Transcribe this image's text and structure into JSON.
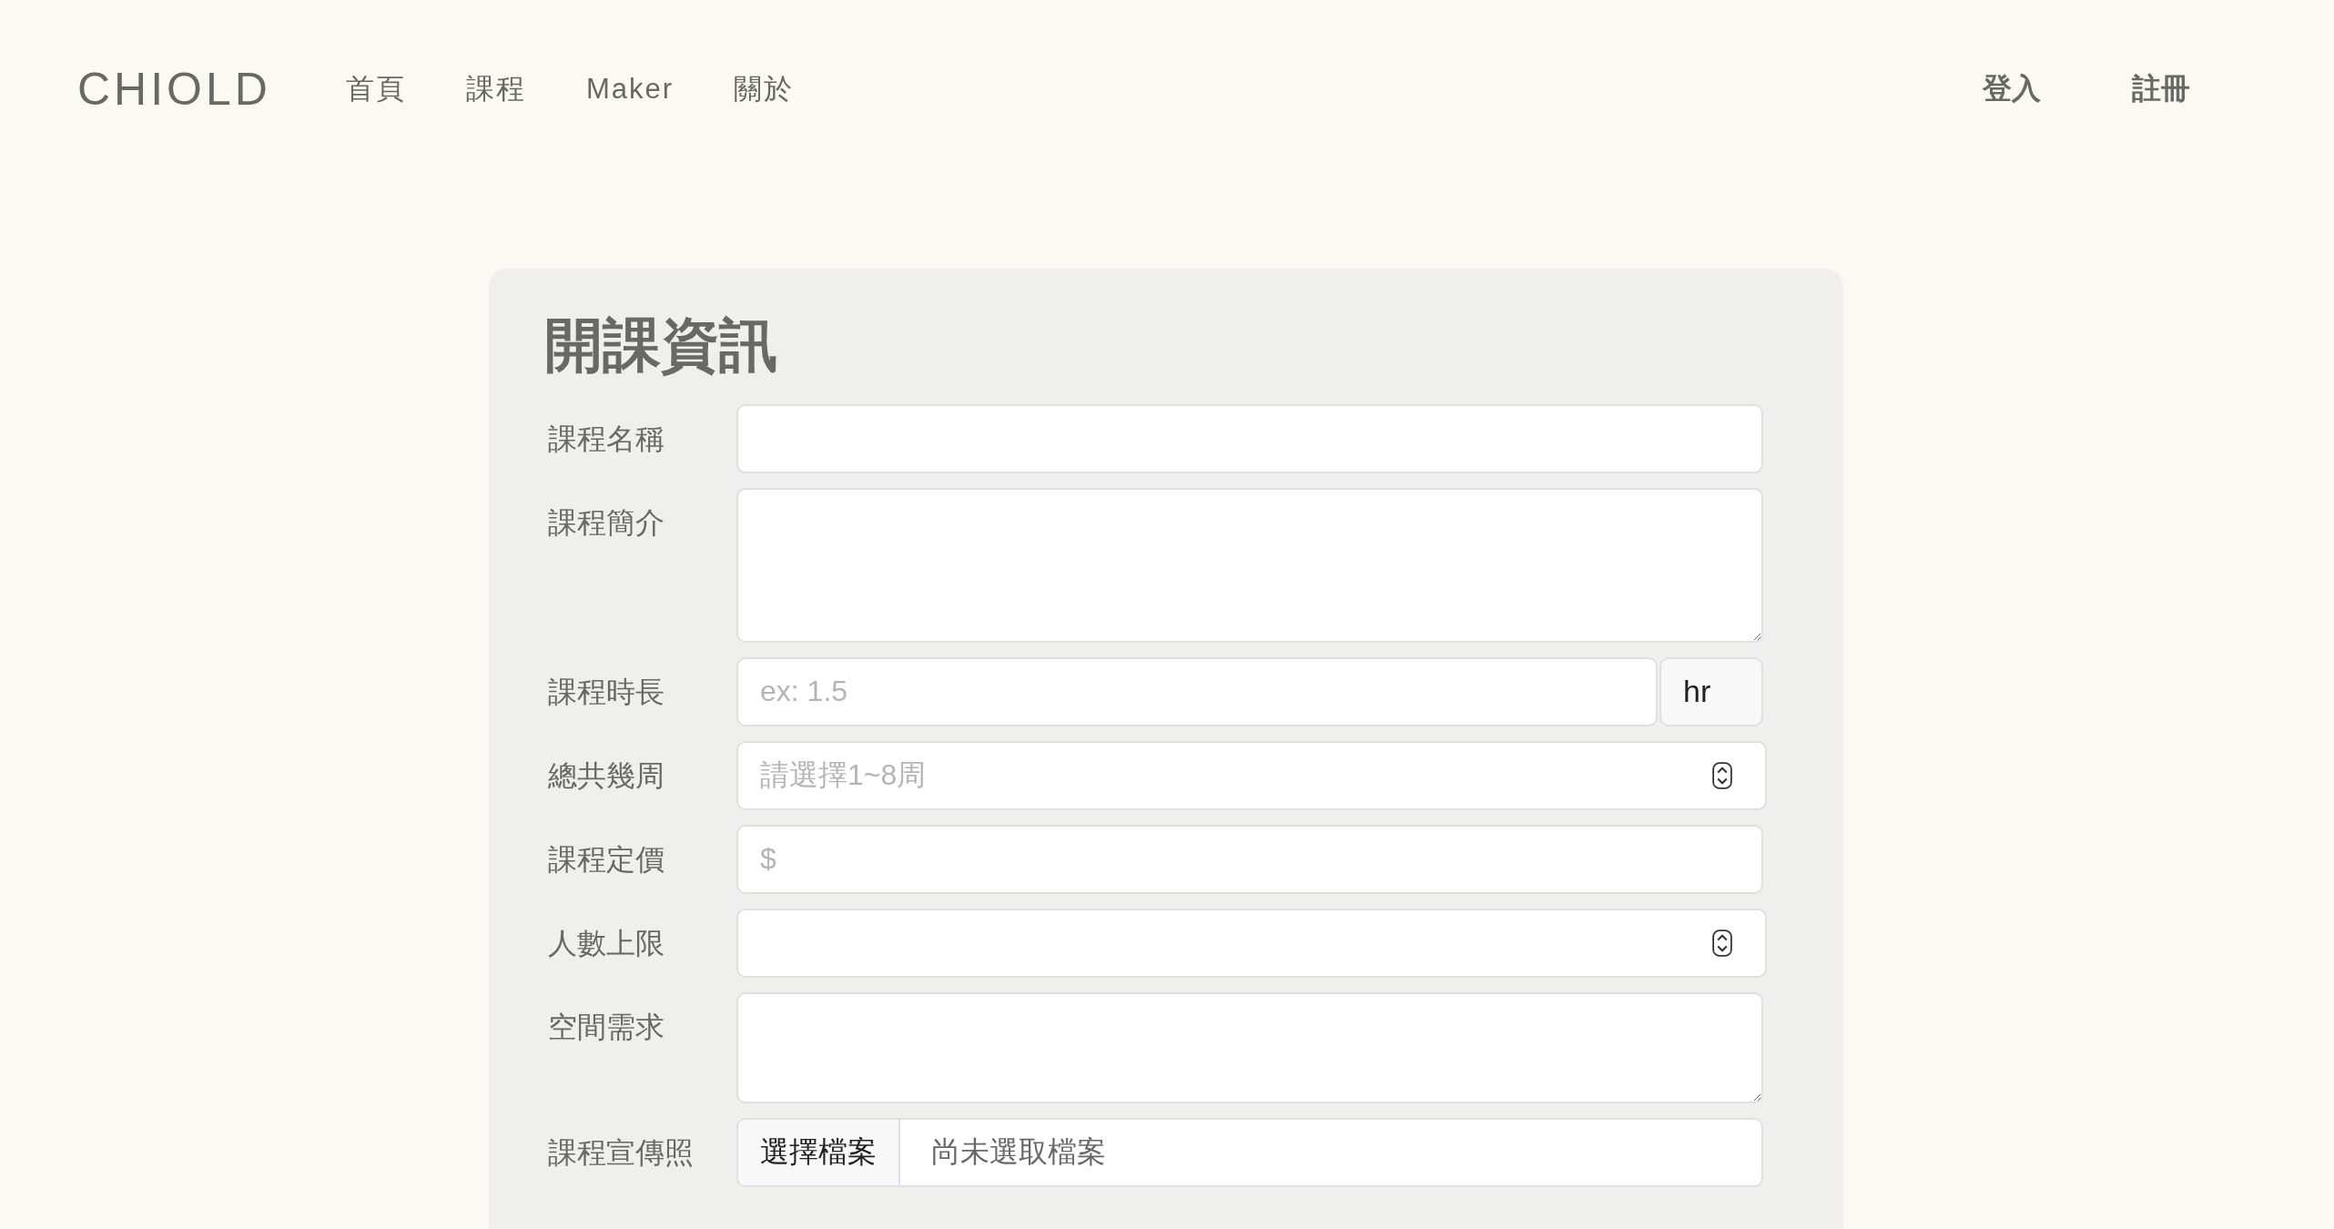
{
  "navbar": {
    "brand": "CHIOLD",
    "links": [
      "首頁",
      "課程",
      "Maker",
      "關於"
    ],
    "actions": [
      "登入",
      "註冊"
    ]
  },
  "form": {
    "title": "開課資訊",
    "fields": [
      {
        "label": "課程名稱",
        "kind": "text"
      },
      {
        "label": "課程簡介",
        "kind": "textarea"
      },
      {
        "label": "課程時長",
        "kind": "suffix",
        "placeholder": "ex: 1.5",
        "suffix": "hr"
      },
      {
        "label": "總共幾周",
        "kind": "number",
        "placeholder": "請選擇1~8周"
      },
      {
        "label": "課程定價",
        "kind": "text",
        "placeholder": "$"
      },
      {
        "label": "人數上限",
        "kind": "number"
      },
      {
        "label": "空間需求",
        "kind": "short-textarea"
      },
      {
        "label": "課程宣傳照",
        "kind": "file",
        "button": "選擇檔案",
        "status": "尚未選取檔案"
      }
    ]
  }
}
